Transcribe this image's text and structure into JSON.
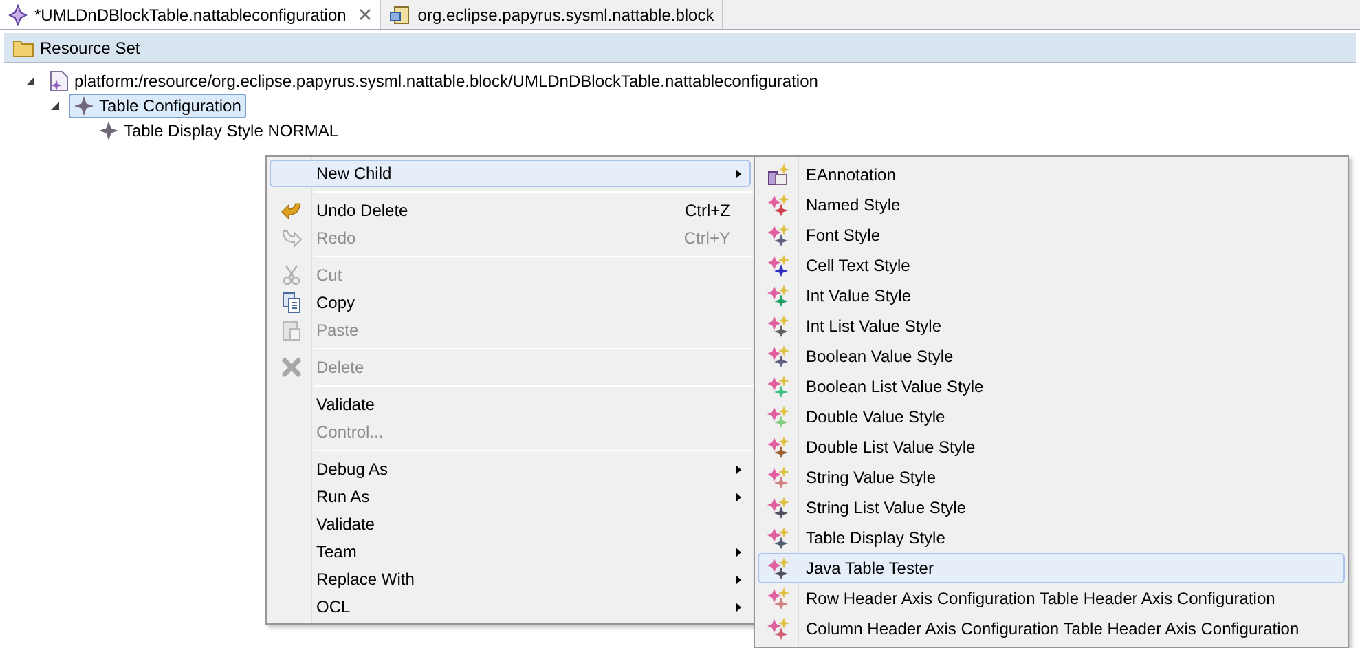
{
  "tabs": [
    {
      "label": "*UMLDnDBlockTable.nattableconfiguration",
      "selected": true,
      "closable": true
    },
    {
      "label": "org.eclipse.papyrus.sysml.nattable.block",
      "selected": false,
      "closable": false
    }
  ],
  "header": {
    "title": "Resource Set"
  },
  "tree": [
    {
      "label": "platform:/resource/org.eclipse.papyrus.sysml.nattable.block/UMLDnDBlockTable.nattableconfiguration",
      "kind": "resource",
      "expanded": true,
      "selected": false,
      "children": [
        {
          "label": "Table Configuration",
          "kind": "element",
          "expanded": true,
          "selected": true,
          "children": [
            {
              "label": "Table Display Style NORMAL",
              "kind": "element",
              "selected": false
            }
          ]
        }
      ]
    }
  ],
  "context_menu": {
    "groups": [
      [
        {
          "label": "New Child",
          "kind": "plain",
          "disabled": false,
          "selected": true,
          "submenu": true
        }
      ],
      [
        {
          "label": "Undo Delete",
          "kind": "undo",
          "shortcut": "Ctrl+Z",
          "disabled": false,
          "selected": false,
          "submenu": false
        },
        {
          "label": "Redo",
          "kind": "redo",
          "shortcut": "Ctrl+Y",
          "disabled": true,
          "selected": false,
          "submenu": false
        }
      ],
      [
        {
          "label": "Cut",
          "kind": "cut",
          "disabled": true,
          "selected": false,
          "submenu": false
        },
        {
          "label": "Copy",
          "kind": "copy",
          "disabled": false,
          "selected": false,
          "submenu": false
        },
        {
          "label": "Paste",
          "kind": "paste",
          "disabled": true,
          "selected": false,
          "submenu": false
        }
      ],
      [
        {
          "label": "Delete",
          "kind": "delete",
          "disabled": true,
          "selected": false,
          "submenu": false
        }
      ],
      [
        {
          "label": "Validate",
          "kind": "plain",
          "disabled": false,
          "selected": false,
          "submenu": false
        },
        {
          "label": "Control...",
          "kind": "plain",
          "disabled": true,
          "selected": false,
          "submenu": false
        }
      ],
      [
        {
          "label": "Debug As",
          "kind": "plain",
          "disabled": false,
          "selected": false,
          "submenu": true
        },
        {
          "label": "Run As",
          "kind": "plain",
          "disabled": false,
          "selected": false,
          "submenu": true
        },
        {
          "label": "Validate",
          "kind": "plain",
          "disabled": false,
          "selected": false,
          "submenu": false
        },
        {
          "label": "Team",
          "kind": "plain",
          "disabled": false,
          "selected": false,
          "submenu": true
        },
        {
          "label": "Replace With",
          "kind": "plain",
          "disabled": false,
          "selected": false,
          "submenu": true
        },
        {
          "label": "OCL",
          "kind": "plain",
          "disabled": false,
          "selected": false,
          "submenu": true
        }
      ]
    ]
  },
  "submenu": {
    "items": [
      {
        "label": "EAnnotation",
        "kind": "annotation",
        "selected": false
      },
      {
        "label": "Named Style",
        "kind": "style",
        "color": "#d04050",
        "selected": false
      },
      {
        "label": "Font Style",
        "kind": "style",
        "color": "#606080",
        "selected": false
      },
      {
        "label": "Cell Text Style",
        "kind": "style",
        "color": "#3030c0",
        "selected": false
      },
      {
        "label": "Int Value Style",
        "kind": "style",
        "color": "#20a060",
        "selected": false
      },
      {
        "label": "Int List Value Style",
        "kind": "style",
        "color": "#606060",
        "selected": false
      },
      {
        "label": "Boolean Value Style",
        "kind": "style",
        "color": "#606080",
        "selected": false
      },
      {
        "label": "Boolean List Value Style",
        "kind": "style",
        "color": "#40c080",
        "selected": false
      },
      {
        "label": "Double Value Style",
        "kind": "style",
        "color": "#80d080",
        "selected": false
      },
      {
        "label": "Double List Value Style",
        "kind": "style",
        "color": "#a06030",
        "selected": false
      },
      {
        "label": "String Value Style",
        "kind": "style",
        "color": "#d08080",
        "selected": false
      },
      {
        "label": "String List Value Style",
        "kind": "style",
        "color": "#505060",
        "selected": false
      },
      {
        "label": "Table Display Style",
        "kind": "style",
        "color": "#506070",
        "selected": false
      },
      {
        "label": "Java Table Tester",
        "kind": "style",
        "color": "#505060",
        "selected": true
      },
      {
        "label": "Row Header Axis Configuration Table Header Axis Configuration",
        "kind": "style",
        "color": "#d08080",
        "selected": false
      },
      {
        "label": "Column Header Axis Configuration Table Header Axis Configuration",
        "kind": "style",
        "color": "#d06070",
        "selected": false
      }
    ]
  }
}
